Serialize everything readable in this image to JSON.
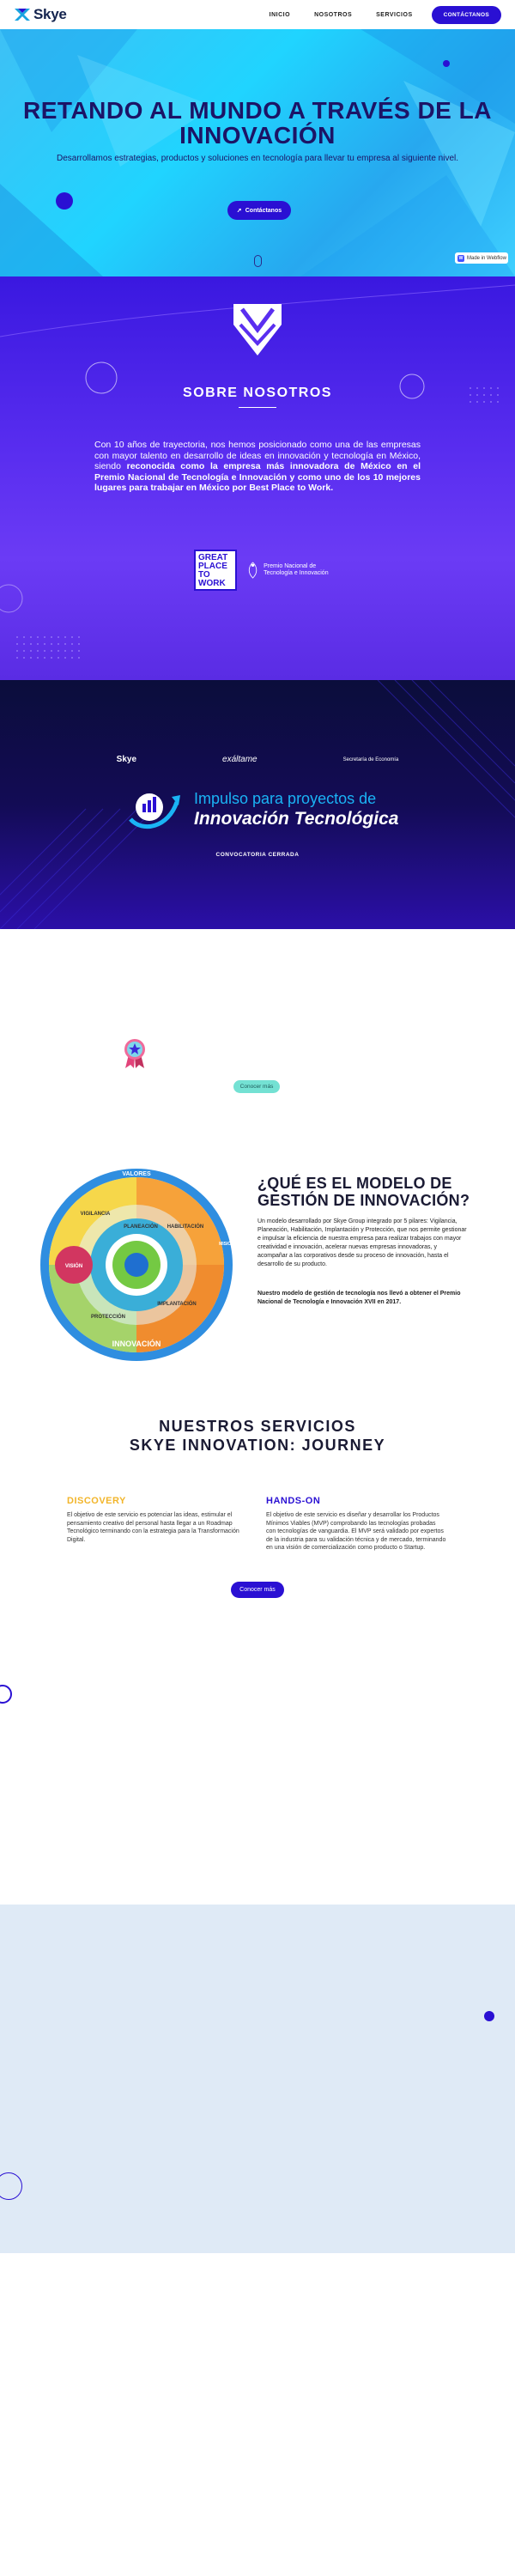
{
  "nav": {
    "logo_text": "Skye",
    "links": [
      "INICIO",
      "NOSOTROS",
      "SERVICIOS"
    ],
    "cta": "CONTÁCTANOS"
  },
  "hero": {
    "title": "RETANDO AL MUNDO A TRAVÉS DE LA INNOVACIÓN",
    "subtitle": "Desarrollamos estrategias, productos y soluciones en tecnología para llevar tu empresa al siguiente nivel.",
    "button": "Contáctanos",
    "badge": "Made in Webflow"
  },
  "about": {
    "title": "SOBRE NOSOTROS",
    "text_plain": "Con 10 años de trayectoria, nos hemos posicionado como una de las empresas con mayor talento en desarrollo de ideas en innovación y tecnología en México, siendo ",
    "text_bold": "reconocida como la empresa más innovadora de México en el Premio Nacional de Tecnología e Innovación y como uno de los 10 mejores lugares para trabajar en México por Best Place to Work.",
    "gptw": "GREAT PLACE TO WORK",
    "premio": "Premio Nacional de Tecnología e Innovación"
  },
  "innovation": {
    "logos": [
      "Skye",
      "exáltame",
      "Secretaría de Economía"
    ],
    "line1": "Impulso para proyectos de",
    "line2": "Innovación Tecnológica",
    "status": "CONVOCATORIA CERRADA"
  },
  "badge_section": {
    "button": "Conocer más"
  },
  "model": {
    "title": "¿QUÉ ES EL MODELO DE GESTIÓN DE INNOVACIÓN?",
    "p1": "Un modelo desarrollado por Skye Group integrado por 5 pilares: Vigilancia, Planeación, Habilitación, Implantación y Protección, que nos permite gestionar e impulsar la eficiencia de nuestra empresa para realizar trabajos con mayor creatividad e innovación, acelerar nuevas empresas innovadoras, y acompañar a las corporativos desde su proceso de innovación, hasta el desarrollo de su producto.",
    "p2": "Nuestro modelo de gestión de tecnología nos llevó a obtener el Premio Nacional de Tecnología e Innovación XVII en 2017.",
    "wheel_labels": [
      "VALORES",
      "INNOVACIÓN",
      "VISIÓN",
      "MISIÓN",
      "PLANEACIÓN",
      "VIGILANCIA",
      "HABILITACIÓN",
      "IMPLANTACIÓN",
      "PROTECCIÓN"
    ]
  },
  "services": {
    "title_line1": "NUESTROS SERVICIOS",
    "title_line2": "SKYE INNOVATION: JOURNEY",
    "cols": [
      {
        "head": "DISCOVERY",
        "color": "#f2b52a",
        "body": "El objetivo de este servicio es potenciar las ideas, estimular el pensamiento creativo del personal hasta llegar a un Roadmap Tecnológico terminando con la estrategia para la Transformación Digital."
      },
      {
        "head": "HANDS-ON",
        "color": "#2a10d3",
        "body": "El objetivo de este servicio es diseñar y desarrollar los Productos Mínimos Viables (MVP) comprobando las tecnologías probadas con tecnologías de vanguardia. El MVP será validado por expertos de la industria para su validación técnica y de mercado, terminando en una visión de comercialización como producto o Startup."
      }
    ],
    "button": "Conocer más"
  }
}
